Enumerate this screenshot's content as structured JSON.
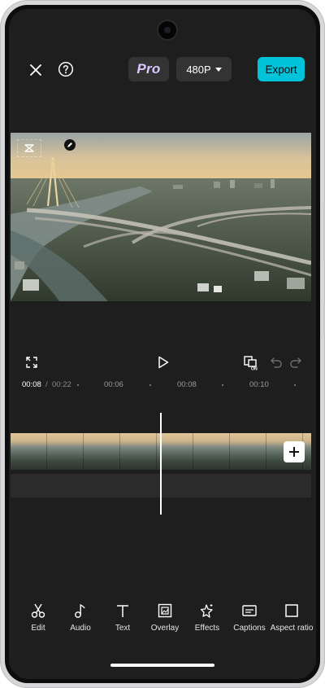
{
  "topbar": {
    "close_icon": "close-icon",
    "help_icon": "help-icon",
    "pro_label": "Pro",
    "resolution": "480P",
    "export_label": "Export"
  },
  "playback": {
    "current_time": "00:08",
    "separator": "/",
    "total_time": "00:22",
    "ticks": [
      "00:06",
      "00:08",
      "00:10"
    ]
  },
  "toolbar": {
    "items": [
      {
        "label": "Edit",
        "icon": "scissors-icon"
      },
      {
        "label": "Audio",
        "icon": "music-note-icon"
      },
      {
        "label": "Text",
        "icon": "text-icon"
      },
      {
        "label": "Overlay",
        "icon": "overlay-icon"
      },
      {
        "label": "Effects",
        "icon": "effects-icon"
      },
      {
        "label": "Captions",
        "icon": "captions-icon"
      },
      {
        "label": "Aspect ratio",
        "icon": "aspect-ratio-icon"
      }
    ]
  },
  "colors": {
    "accent": "#00c2d8",
    "background": "#1e1e1e"
  }
}
